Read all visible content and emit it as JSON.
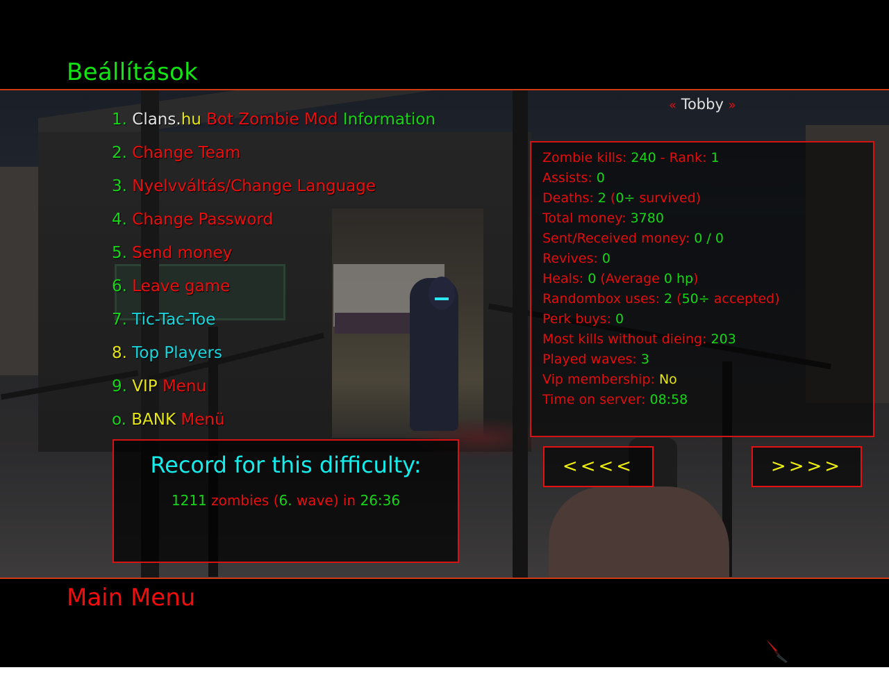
{
  "header": {
    "title": "Beállítások"
  },
  "footer": {
    "title": "Main Menu"
  },
  "menu": {
    "items": [
      {
        "key": "1.",
        "parts": [
          {
            "text": "Clans.",
            "color": "white"
          },
          {
            "text": "hu",
            "color": "yellow"
          },
          {
            "text": " Bot Zombie Mod",
            "color": "red"
          },
          {
            "text": " Information",
            "color": "green"
          }
        ]
      },
      {
        "key": "2.",
        "parts": [
          {
            "text": "Change Team",
            "color": "red"
          }
        ]
      },
      {
        "key": "3.",
        "parts": [
          {
            "text": "Nyelvváltás/Change Language",
            "color": "red"
          }
        ]
      },
      {
        "key": "4.",
        "parts": [
          {
            "text": "Change Password",
            "color": "red"
          }
        ]
      },
      {
        "key": "5.",
        "parts": [
          {
            "text": "Send money",
            "color": "red"
          }
        ]
      },
      {
        "key": "6.",
        "parts": [
          {
            "text": "Leave game",
            "color": "red"
          }
        ]
      },
      {
        "key": "7.",
        "parts": [
          {
            "text": "Tic-Tac-Toe",
            "color": "cyan"
          }
        ]
      },
      {
        "key": "8.",
        "key_color": "yellow",
        "parts": [
          {
            "text": "Top Players",
            "color": "cyan"
          }
        ]
      },
      {
        "key": "9.",
        "parts": [
          {
            "text": "VIP",
            "color": "yellow"
          },
          {
            "text": " Menu",
            "color": "red"
          }
        ]
      },
      {
        "key": "o.",
        "parts": [
          {
            "text": "BANK",
            "color": "yellow"
          },
          {
            "text": " Menü",
            "color": "red"
          }
        ]
      }
    ]
  },
  "player": {
    "name": "Tobby",
    "left_quote": "«",
    "right_quote": "»",
    "stats": [
      {
        "label": "Zombie kills: ",
        "value": "240",
        "suffix_label": " - Rank: ",
        "suffix_value": "1"
      },
      {
        "label": "Assists: ",
        "value": "0"
      },
      {
        "label": "Deaths: ",
        "value": "2",
        "extra_open": " (",
        "extra_value": "0÷",
        "extra_close": " survived)"
      },
      {
        "label": "Total money: ",
        "value": "3780"
      },
      {
        "label": "Sent/Received money: ",
        "value": "0 / 0"
      },
      {
        "label": "Revives: ",
        "value": "0"
      },
      {
        "label": "Heals: ",
        "value": "0",
        "extra_open": " (Average ",
        "extra_value": "0 hp",
        "extra_close": ")"
      },
      {
        "label": "Randombox uses: ",
        "value": "2",
        "extra_open": " (",
        "extra_value": "50÷",
        "extra_close": " accepted)"
      },
      {
        "label": "Perk buys: ",
        "value": "0"
      },
      {
        "label": "Most kills without dieing: ",
        "value": "203"
      },
      {
        "label": "Played waves: ",
        "value": "3"
      },
      {
        "label": "Vip membership: ",
        "value": "No",
        "value_color": "yellow"
      },
      {
        "label": "Time on server: ",
        "value": "08:58"
      }
    ]
  },
  "record": {
    "title": "Record for this difficulty:",
    "zombies": "1211",
    "zombies_label": " zombies (",
    "wave": "6.",
    "wave_label": " wave) in ",
    "time": "26:36"
  },
  "nav": {
    "prev_label": "<<<<",
    "next_label": ">>>>"
  },
  "icons": {
    "weapon": "knife-icon"
  },
  "colors": {
    "green": "#15d615",
    "red": "#ea0e0e",
    "yellow": "#e6e614",
    "cyan": "#18d6dc",
    "white": "#e2e2e2",
    "separator": "#d23a14",
    "box_border": "#d41414"
  }
}
